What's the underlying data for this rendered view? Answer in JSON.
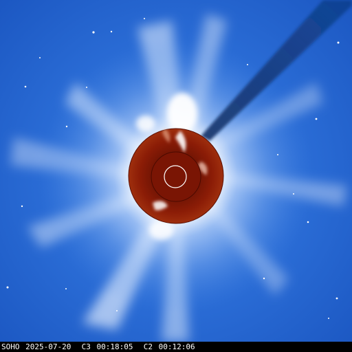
{
  "image": {
    "subject": "LASCO C2/C3 composite coronagraph view",
    "background_color": "#1f5fc7",
    "corona_color": "#e8f2ff",
    "occulter_color": "#8b1c06",
    "sun_disk_outline_color": "#ffffff",
    "comet_streak_color": "#0f3a7a"
  },
  "caption": {
    "observatory": "SOHO",
    "date": "2025-07-20",
    "c3_label": "C3",
    "c3_time": "00:18:05",
    "c2_label": "C2",
    "c2_time": "00:12:06"
  }
}
